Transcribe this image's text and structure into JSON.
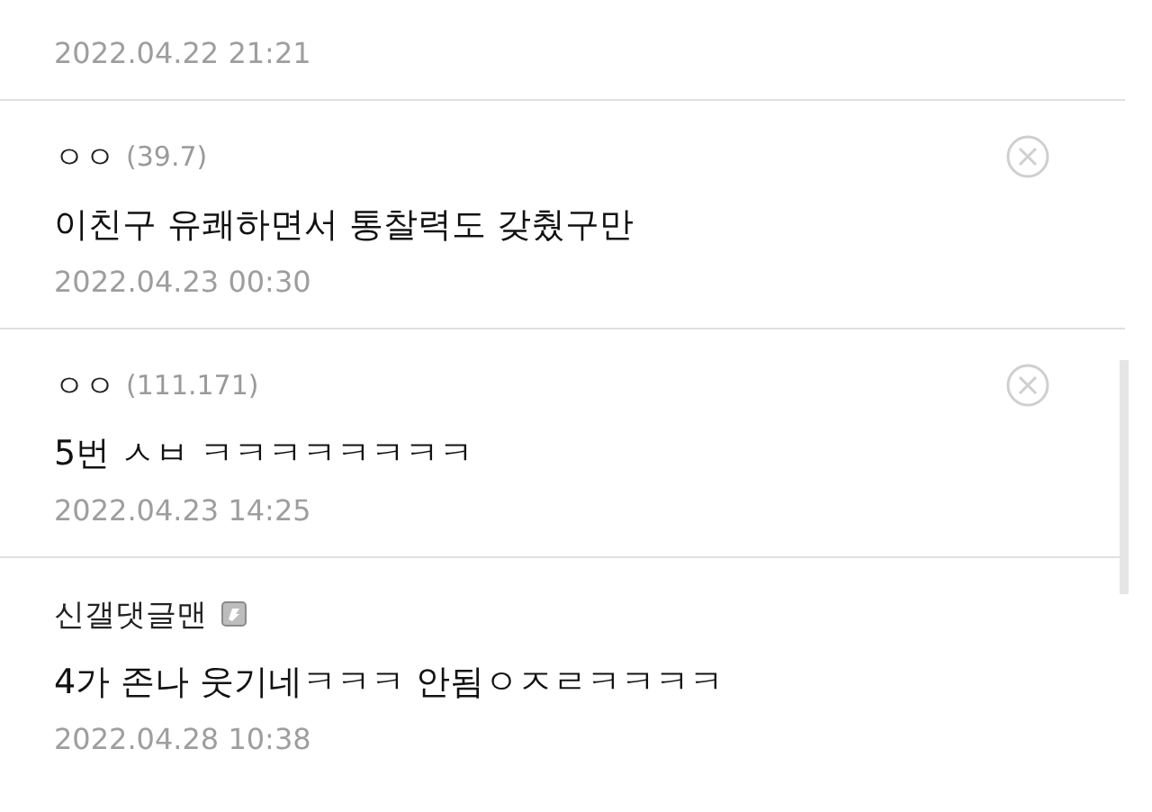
{
  "top_comment": {
    "date": "2022.04.22 21:21"
  },
  "comments": [
    {
      "kind": "guest",
      "name": "ㅇㅇ",
      "ip": "(39.7)",
      "text": "이친구 유쾌하면서 통찰력도 갖췄구만",
      "date": "2022.04.23 00:30",
      "deletable": true
    },
    {
      "kind": "guest",
      "name": "ㅇㅇ",
      "ip": "(111.171)",
      "text": "5번 ㅅㅂ ㅋㅋㅋㅋㅋㅋㅋㅋ",
      "date": "2022.04.23 14:25",
      "deletable": true
    },
    {
      "kind": "member",
      "name": "신갤댓글맨",
      "text": "4가 존나 웃기네ㅋㅋㅋ 안됨ㅇㅈㄹㅋㅋㅋㅋ",
      "date": "2022.04.28 10:38",
      "deletable": false
    }
  ]
}
